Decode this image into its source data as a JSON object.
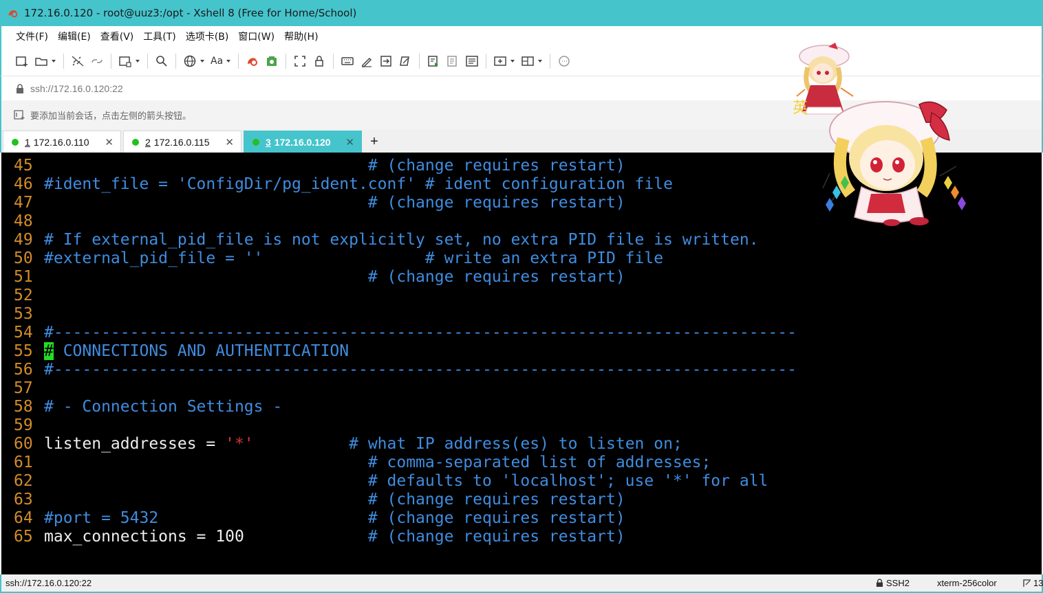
{
  "window": {
    "title": "172.16.0.120 - root@uuz3:/opt - Xshell 8 (Free for Home/School)",
    "title_color": "#45c4cc"
  },
  "menu": {
    "items": [
      "文件(F)",
      "编辑(E)",
      "查看(V)",
      "工具(T)",
      "选项卡(B)",
      "窗口(W)",
      "帮助(H)"
    ]
  },
  "toolbar": {
    "font_label": "Aa",
    "icons": [
      "new-session-icon",
      "open-folder-icon",
      "disconnect-icon",
      "reconnect-icon",
      "new-window-icon",
      "find-icon",
      "globe-icon",
      "font-icon",
      "xshell-icon",
      "xftp-icon",
      "fullscreen-icon",
      "lock-icon",
      "keyboard-icon",
      "script-icon",
      "transfer-icon",
      "compose-icon",
      "send-icon",
      "log-icon",
      "notes-icon",
      "add-tab-icon",
      "layout-icon",
      "chat-icon"
    ]
  },
  "address": {
    "value": "ssh://172.16.0.120:22"
  },
  "hint": {
    "text": "要添加当前会话，点击左侧的箭头按钮。"
  },
  "tabs": [
    {
      "num": "1",
      "label": "172.16.0.110",
      "active": false
    },
    {
      "num": "2",
      "label": "172.16.0.115",
      "active": false
    },
    {
      "num": "3",
      "label": "172.16.0.120",
      "active": true
    }
  ],
  "terminal": {
    "lines": [
      {
        "n": "45",
        "segments": [
          {
            "t": "                                  ",
            "c": "c-white"
          },
          {
            "t": "# (change requires restart)",
            "c": "c-comment"
          }
        ]
      },
      {
        "n": "46",
        "segments": [
          {
            "t": "#ident_file = 'ConfigDir/pg_ident.conf' # ident configuration file",
            "c": "c-comment"
          }
        ]
      },
      {
        "n": "47",
        "segments": [
          {
            "t": "                                  ",
            "c": "c-white"
          },
          {
            "t": "# (change requires restart)",
            "c": "c-comment"
          }
        ]
      },
      {
        "n": "48",
        "segments": []
      },
      {
        "n": "49",
        "segments": [
          {
            "t": "# If external_pid_file is not explicitly set, no extra PID file is written.",
            "c": "c-comment"
          }
        ]
      },
      {
        "n": "50",
        "segments": [
          {
            "t": "#external_pid_file = ''                 # write an extra PID file",
            "c": "c-comment"
          }
        ]
      },
      {
        "n": "51",
        "segments": [
          {
            "t": "                                  ",
            "c": "c-white"
          },
          {
            "t": "# (change requires restart)",
            "c": "c-comment"
          }
        ]
      },
      {
        "n": "52",
        "segments": []
      },
      {
        "n": "53",
        "segments": []
      },
      {
        "n": "54",
        "segments": [
          {
            "t": "#------------------------------------------------------------------------------",
            "c": "c-comment"
          }
        ]
      },
      {
        "n": "55",
        "segments": [
          {
            "t": "#",
            "c": "c-cursor"
          },
          {
            "t": " CONNECTIONS AND AUTHENTICATION",
            "c": "c-comment"
          }
        ]
      },
      {
        "n": "56",
        "segments": [
          {
            "t": "#------------------------------------------------------------------------------",
            "c": "c-comment"
          }
        ]
      },
      {
        "n": "57",
        "segments": []
      },
      {
        "n": "58",
        "segments": [
          {
            "t": "# - Connection Settings -",
            "c": "c-comment"
          }
        ]
      },
      {
        "n": "59",
        "segments": []
      },
      {
        "n": "60",
        "segments": [
          {
            "t": "listen_addresses = ",
            "c": "c-white"
          },
          {
            "t": "'*'",
            "c": "c-str"
          },
          {
            "t": "          ",
            "c": "c-white"
          },
          {
            "t": "# what IP address(es) to listen on;",
            "c": "c-comment"
          }
        ]
      },
      {
        "n": "61",
        "segments": [
          {
            "t": "                                  ",
            "c": "c-white"
          },
          {
            "t": "# comma-separated list of addresses;",
            "c": "c-comment"
          }
        ]
      },
      {
        "n": "62",
        "segments": [
          {
            "t": "                                  ",
            "c": "c-white"
          },
          {
            "t": "# defaults to 'localhost'; use '*' for all",
            "c": "c-comment"
          }
        ]
      },
      {
        "n": "63",
        "segments": [
          {
            "t": "                                  ",
            "c": "c-white"
          },
          {
            "t": "# (change requires restart)",
            "c": "c-comment"
          }
        ]
      },
      {
        "n": "64",
        "segments": [
          {
            "t": "#port = 5432",
            "c": "c-comment"
          },
          {
            "t": "                      ",
            "c": "c-white"
          },
          {
            "t": "# (change requires restart)",
            "c": "c-comment"
          }
        ]
      },
      {
        "n": "65",
        "segments": [
          {
            "t": "max_connections = 100",
            "c": "c-white"
          },
          {
            "t": "             ",
            "c": "c-white"
          },
          {
            "t": "# (change requires restart)",
            "c": "c-comment"
          }
        ]
      }
    ]
  },
  "status": {
    "address": "ssh://172.16.0.120:22",
    "protocol": "SSH2",
    "term_type": "xterm-256color",
    "size": "13"
  },
  "mascot": {
    "ime_char": "英"
  }
}
